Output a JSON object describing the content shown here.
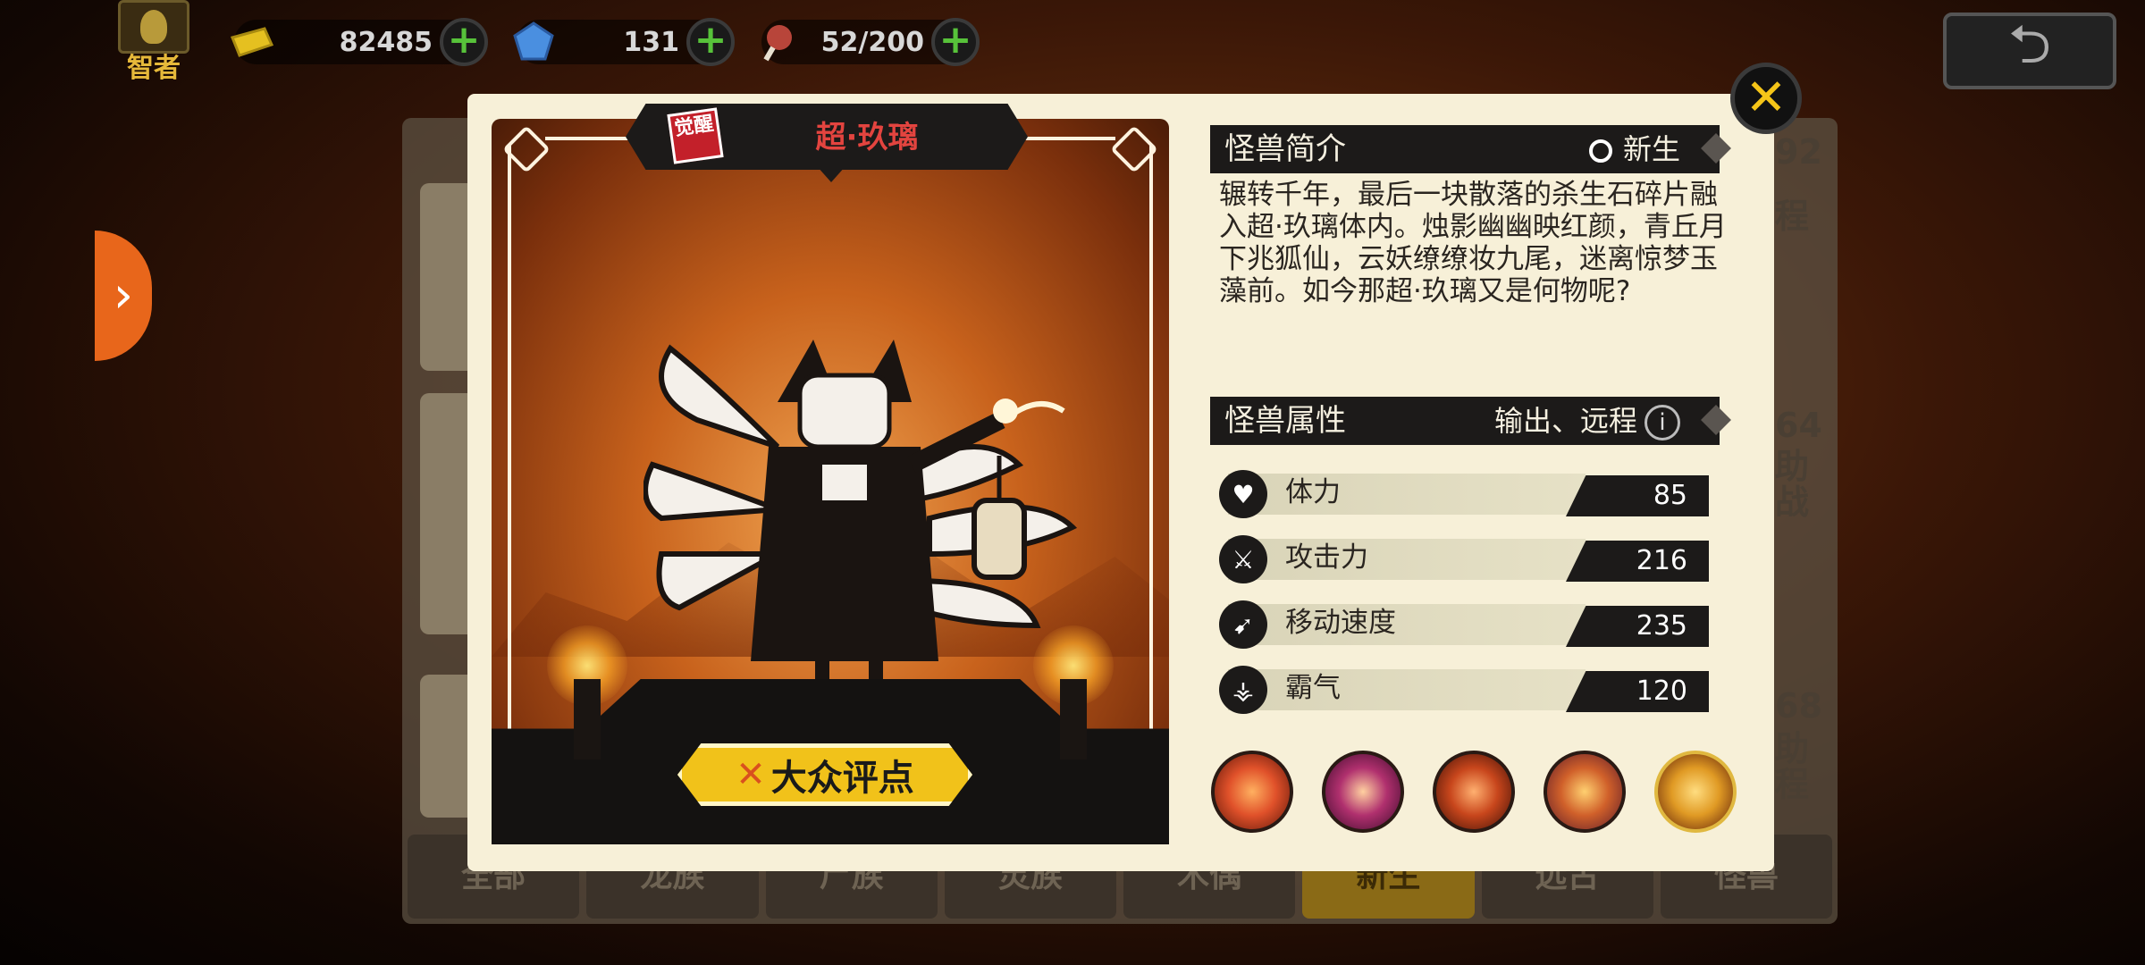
{
  "hud": {
    "rank_label": "智者",
    "gold": "82485",
    "gems": "131",
    "stamina": "52/200",
    "plus": "+"
  },
  "side_tab_glyph": "›",
  "back_glyph": "⮌",
  "background_list": {
    "right_partials": [
      "92",
      "程",
      "64",
      "助",
      "战",
      "68",
      "助",
      "程"
    ],
    "tabs": [
      "全部",
      "龙族",
      "尸族",
      "灵族",
      "木偶",
      "新生",
      "远古",
      "怪兽"
    ],
    "active_tab": "新生"
  },
  "monster": {
    "badge": "觉醒",
    "name": "超·玖璃",
    "rate_button_icon": "✕",
    "rate_button": "大众评点"
  },
  "intro": {
    "title": "怪兽简介",
    "faction": "新生",
    "description": "辗转千年，最后一块散落的杀生石碎片融入超·玖璃体内。烛影幽幽映红颜，青丘月下兆狐仙，云妖缭缭妆九尾，迷离惊梦玉藻前。如今那超·玖璃又是何物呢?"
  },
  "attributes": {
    "title": "怪兽属性",
    "role": "输出、远程",
    "info": "i",
    "stats": [
      {
        "name": "体力",
        "value": "85",
        "icon": "heart-icon"
      },
      {
        "name": "攻击力",
        "value": "216",
        "icon": "sword-icon"
      },
      {
        "name": "移动速度",
        "value": "235",
        "icon": "boot-icon"
      },
      {
        "name": "霸气",
        "value": "120",
        "icon": "claw-icon"
      }
    ]
  },
  "skills": [
    {
      "name": "fire-skill-icon",
      "color": "#e0512a"
    },
    {
      "name": "orb-skill-icon",
      "color": "#b0306e"
    },
    {
      "name": "slash-skill-icon",
      "color": "#c8461c"
    },
    {
      "name": "shield-skill-icon",
      "color": "#d0602a"
    },
    {
      "name": "fox-skill-icon",
      "color": "#e09a24"
    }
  ],
  "colors": {
    "accent_gold": "#f1c21a",
    "name_red": "#e3443f",
    "plus_green": "#57c23a"
  }
}
